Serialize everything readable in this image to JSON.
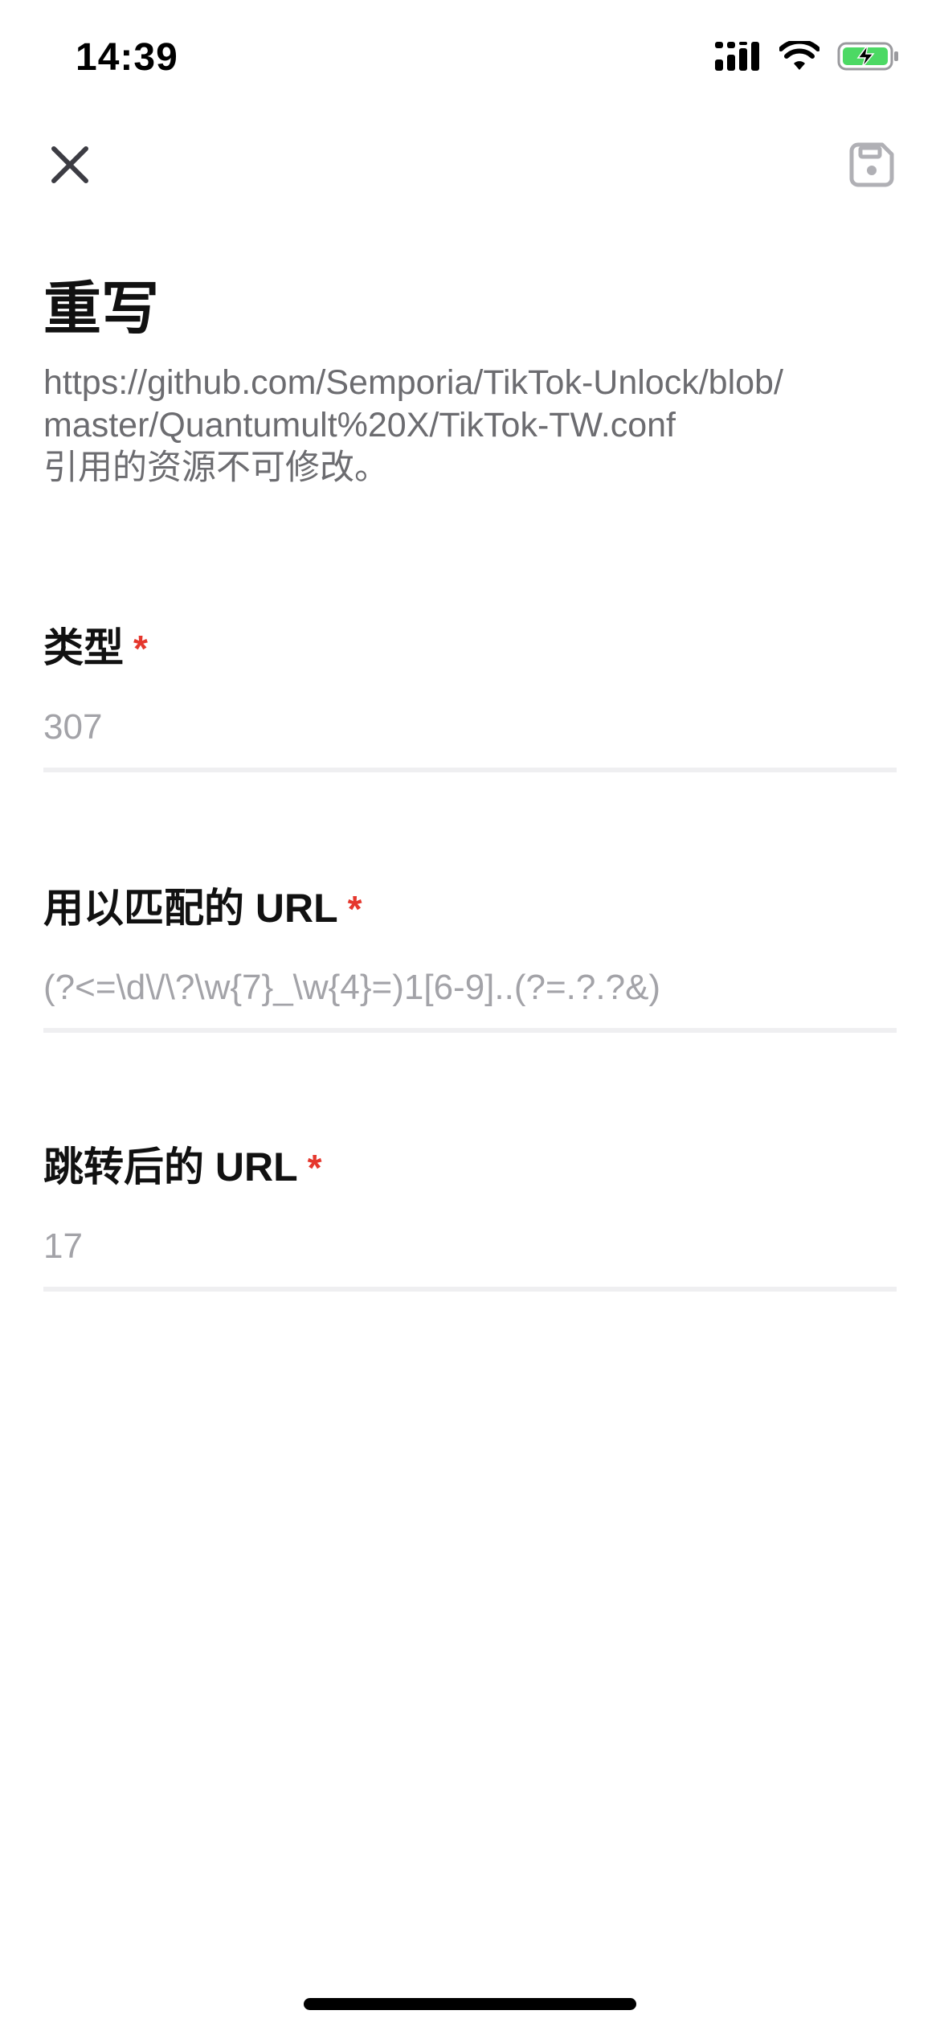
{
  "status_bar": {
    "time": "14:39"
  },
  "nav": {
    "close_icon": "close-icon",
    "save_icon": "save-icon"
  },
  "page": {
    "title": "重写",
    "source_line1": "https://github.com/Semporia/TikTok-Unlock/blob/",
    "source_line2": "master/Quantumult%20X/TikTok-TW.conf",
    "source_note": "引用的资源不可修改。"
  },
  "fields": [
    {
      "label": "类型",
      "required": "*",
      "value": "307"
    },
    {
      "label": "用以匹配的 URL",
      "required": "*",
      "value": "(?<=\\d\\/\\?\\w{7}_\\w{4}=)1[6-9]..(?=.?.?&)"
    },
    {
      "label": "跳转后的 URL",
      "required": "*",
      "value": "17"
    }
  ],
  "colors": {
    "required": "#e5372d",
    "battery": "#4cd964",
    "placeholder": "#a3a3a8"
  }
}
